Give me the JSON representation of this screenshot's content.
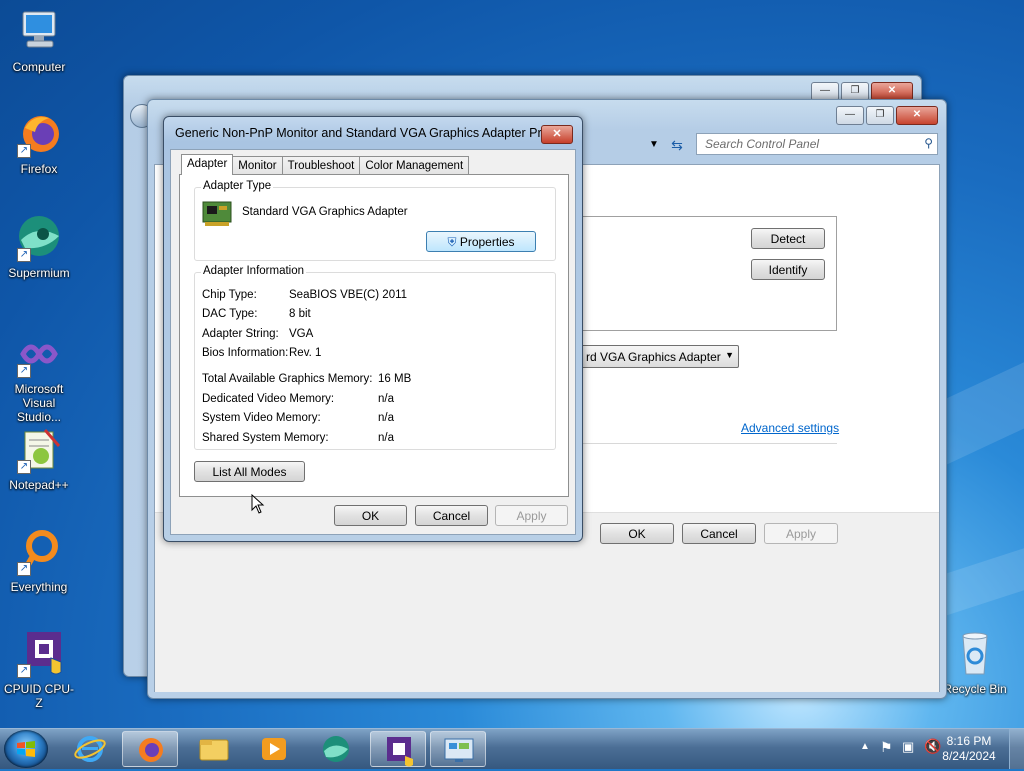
{
  "desktop_icons": [
    {
      "label": "Computer",
      "icon": "computer-icon"
    },
    {
      "label": "Firefox",
      "icon": "firefox-icon"
    },
    {
      "label": "Supermium",
      "icon": "supermium-icon"
    },
    {
      "label": "Microsoft Visual Studio...",
      "icon": "visual-studio-icon"
    },
    {
      "label": "Notepad++",
      "icon": "notepadpp-icon"
    },
    {
      "label": "Everything",
      "icon": "everything-icon"
    },
    {
      "label": "CPUID CPU-Z",
      "icon": "cpuz-icon"
    },
    {
      "label": "Recycle Bin",
      "icon": "recycle-bin-icon"
    }
  ],
  "control_panel": {
    "search_placeholder": "Search Control Panel",
    "detect_label": "Detect",
    "identify_label": "Identify",
    "display_select": "rd VGA Graphics Adapter",
    "advanced_link": "Advanced settings",
    "ok_label": "OK",
    "cancel_label": "Cancel",
    "apply_label": "Apply"
  },
  "dialog": {
    "title": "Generic Non-PnP Monitor and Standard VGA Graphics Adapter Pro...",
    "tabs": [
      "Adapter",
      "Monitor",
      "Troubleshoot",
      "Color Management"
    ],
    "adapter_type_legend": "Adapter Type",
    "adapter_name": "Standard VGA Graphics Adapter",
    "properties_label": "Properties",
    "adapter_info_legend": "Adapter Information",
    "info": [
      {
        "label": "Chip Type:",
        "value": "SeaBIOS VBE(C) 2011"
      },
      {
        "label": "DAC Type:",
        "value": "8 bit"
      },
      {
        "label": "Adapter String:",
        "value": "VGA"
      },
      {
        "label": "Bios Information:",
        "value": "Rev. 1"
      }
    ],
    "memory": [
      {
        "label": "Total Available Graphics Memory:",
        "value": "16 MB"
      },
      {
        "label": "Dedicated Video Memory:",
        "value": "n/a"
      },
      {
        "label": "System Video Memory:",
        "value": "n/a"
      },
      {
        "label": "Shared System Memory:",
        "value": "n/a"
      }
    ],
    "list_all_modes_label": "List All Modes",
    "ok_label": "OK",
    "cancel_label": "Cancel",
    "apply_label": "Apply"
  },
  "taskbar": {
    "items": [
      "ie-icon",
      "firefox-icon",
      "explorer-icon",
      "media-player-icon",
      "supermium-icon",
      "cpuz-icon",
      "display-settings-icon"
    ],
    "time": "8:16 PM",
    "date": "8/24/2024"
  }
}
